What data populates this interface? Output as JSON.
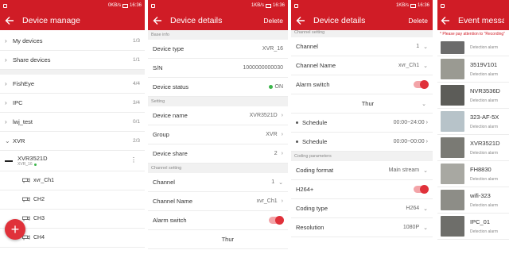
{
  "status": {
    "s1_speed": "0KB/s",
    "s2_speed": "1KB/s",
    "s3_speed": "1KB/s",
    "time": "16:36"
  },
  "screen1": {
    "title": "Device manage",
    "items": [
      {
        "label": "My devices",
        "count": "1/3"
      },
      {
        "label": "Share devices",
        "count": "1/1"
      }
    ],
    "groups": [
      {
        "label": "FishEye",
        "count": "4/4"
      },
      {
        "label": "IPC",
        "count": "3/4"
      },
      {
        "label": "lwj_test",
        "count": "0/1"
      },
      {
        "label": "XVR",
        "count": "2/3"
      }
    ],
    "device": {
      "name": "XVR3521D",
      "sub": "XVR_16"
    },
    "channels": [
      "xvr_Ch1",
      "CH2",
      "CH3",
      "CH4"
    ],
    "fab": "+"
  },
  "screen2": {
    "title": "Device details",
    "action": "Delete",
    "section_base": "Base info",
    "device_type_label": "Device type",
    "device_type": "XVR_16",
    "sn_label": "S/N",
    "sn": "1000000000030",
    "status_label": "Device status",
    "status": "ON",
    "section_setting": "Setting",
    "device_name_label": "Device name",
    "device_name": "XVR3521D",
    "group_label": "Group",
    "group": "XVR",
    "share_label": "Device share",
    "share": "2",
    "section_channel": "Channel setting",
    "channel_label": "Channel",
    "channel": "1",
    "channel_name_label": "Channel Name",
    "channel_name": "xvr_Ch1",
    "alarm_label": "Alarm switch",
    "day": "Thur"
  },
  "screen3": {
    "title": "Device details",
    "action": "Delete",
    "section_channel": "Channel setting",
    "channel_label": "Channel",
    "channel": "1",
    "channel_name_label": "Channel Name",
    "channel_name": "xvr_Ch1",
    "alarm_label": "Alarm switch",
    "day": "Thur",
    "schedules": [
      {
        "label": "Schedule",
        "value": "00:00~24:00"
      },
      {
        "label": "Schedule",
        "value": "00:00~00:00"
      }
    ],
    "section_coding": "Coding parameters",
    "coding_format_label": "Coding format",
    "coding_format": "Main stream",
    "h264_label": "H264+",
    "coding_type_label": "Coding type",
    "coding_type": "H264",
    "resolution_label": "Resolution",
    "resolution": "1080P"
  },
  "screen4": {
    "title": "Event message",
    "notice": "* Please pay attention to \"Recording\"",
    "events": [
      {
        "name": "",
        "sub": "Detection alarm",
        "color": "#6b6b6b"
      },
      {
        "name": "3519V101",
        "sub": "Detection alarm",
        "color": "#9a9a92"
      },
      {
        "name": "NVR3536D",
        "sub": "Detection alarm",
        "color": "#5c5c58"
      },
      {
        "name": "323-AF-5X",
        "sub": "Detection alarm",
        "color": "#b7c3c9"
      },
      {
        "name": "XVR3521D",
        "sub": "Detection alarm",
        "color": "#7a7a74"
      },
      {
        "name": "FH8830",
        "sub": "Detection alarm",
        "color": "#a8a8a2"
      },
      {
        "name": "wifi-323",
        "sub": "Detection alarm",
        "color": "#8d8d87"
      },
      {
        "name": "IPC_01",
        "sub": "Detection alarm",
        "color": "#6e6e6a"
      }
    ]
  },
  "colors": {
    "brand": "#d01c26",
    "online": "#3bb54a"
  }
}
